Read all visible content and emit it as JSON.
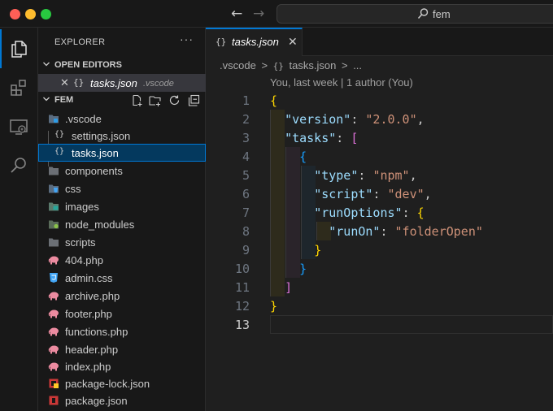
{
  "window": {
    "search_text": "fem",
    "back_arrow": "←",
    "forward_arrow": "→"
  },
  "sidebar": {
    "title": "EXPLORER",
    "more": "···",
    "open_editors": {
      "header": "OPEN EDITORS",
      "items": [
        {
          "close": "✕",
          "icon": "{}",
          "name": "tasks.json",
          "dir": ".vscode"
        }
      ]
    },
    "folder": {
      "header": "FEM",
      "items": [
        {
          "name": ".vscode",
          "icon": "folder-vscode-icon"
        },
        {
          "name": "settings.json",
          "icon": "json-braces-icon"
        },
        {
          "name": "tasks.json",
          "icon": "json-braces-icon"
        },
        {
          "name": "components",
          "icon": "folder-icon"
        },
        {
          "name": "css",
          "icon": "folder-css-icon"
        },
        {
          "name": "images",
          "icon": "folder-images-icon"
        },
        {
          "name": "node_modules",
          "icon": "folder-node-icon"
        },
        {
          "name": "scripts",
          "icon": "folder-icon"
        },
        {
          "name": "404.php",
          "icon": "php-elephant-icon"
        },
        {
          "name": "admin.css",
          "icon": "css-icon"
        },
        {
          "name": "archive.php",
          "icon": "php-elephant-icon"
        },
        {
          "name": "footer.php",
          "icon": "php-elephant-icon"
        },
        {
          "name": "functions.php",
          "icon": "php-elephant-icon"
        },
        {
          "name": "header.php",
          "icon": "php-elephant-icon"
        },
        {
          "name": "index.php",
          "icon": "php-elephant-icon"
        },
        {
          "name": "package-lock.json",
          "icon": "npm-lock-icon"
        },
        {
          "name": "package.json",
          "icon": "npm-icon"
        }
      ]
    }
  },
  "editor": {
    "tab": {
      "icon": "{}",
      "name": "tasks.json",
      "close": "✕"
    },
    "breadcrumb": [
      ".vscode",
      ">",
      "{}",
      "tasks.json",
      ">",
      "..."
    ],
    "blame": "You, last week | 1 author (You)",
    "line_numbers": [
      "1",
      "2",
      "3",
      "4",
      "5",
      "6",
      "7",
      "8",
      "9",
      "10",
      "11",
      "12",
      "13"
    ],
    "code": {
      "l1_open": "{",
      "version_key": "\"version\"",
      "version_val": "\"2.0.0\"",
      "tasks_key": "\"tasks\"",
      "tasks_open": "[",
      "obj_open": "{",
      "type_key": "\"type\"",
      "type_val": "\"npm\"",
      "script_key": "\"script\"",
      "script_val": "\"dev\"",
      "runoptions_key": "\"runOptions\"",
      "runoptions_open": "{",
      "runon_key": "\"runOn\"",
      "runon_val": "\"folderOpen\"",
      "runoptions_close": "}",
      "obj_close": "}",
      "tasks_close": "]",
      "l12_close": "}",
      "colon": ":",
      "comma": ","
    }
  },
  "colors": {
    "accent": "#0078d4",
    "json_key": "#9cdcfe",
    "json_string": "#ce9178",
    "bracket_level1": "#ffd700",
    "bracket_level2": "#da70d6",
    "bracket_level3": "#179fff"
  }
}
